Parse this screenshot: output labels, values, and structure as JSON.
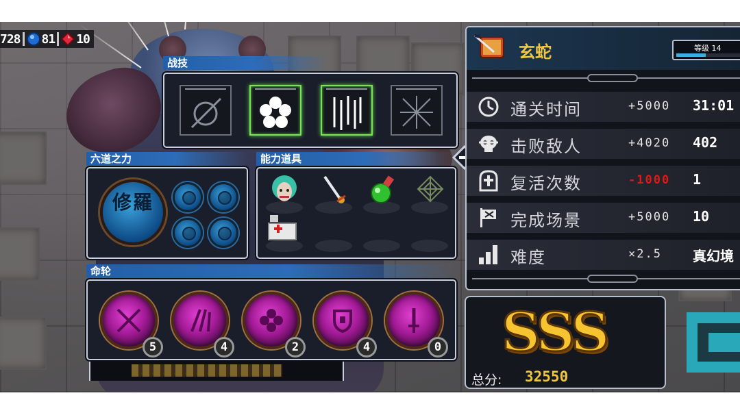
{
  "resources": {
    "coins": "728",
    "blue_gems": "81",
    "red_gems": "10"
  },
  "tabs": {
    "skills": "战技",
    "six_paths": "六道之力",
    "items": "能力道具",
    "fate": "命轮"
  },
  "six_paths": {
    "main_glyph": "修羅"
  },
  "fate_wheel": [
    {
      "icon": "crossed-sword-icon",
      "count": "5"
    },
    {
      "icon": "slash-icon",
      "count": "4"
    },
    {
      "icon": "flower-icon",
      "count": "2"
    },
    {
      "icon": "shield-icon",
      "count": "4"
    },
    {
      "icon": "sword-icon",
      "count": "0"
    }
  ],
  "character": {
    "name": "玄蛇",
    "level_label": "等级 14"
  },
  "stats": [
    {
      "label": "通关时间",
      "bonus": "+5000",
      "value": "31:01",
      "icon": "clock-icon",
      "negative": false
    },
    {
      "label": "击败敌人",
      "bonus": "+4020",
      "value": "402",
      "icon": "skull-icon",
      "negative": false
    },
    {
      "label": "复活次数",
      "bonus": "-1000",
      "value": "1",
      "icon": "tombstone-icon",
      "negative": true
    },
    {
      "label": "完成场景",
      "bonus": "+5000",
      "value": "10",
      "icon": "flag-icon",
      "negative": false
    },
    {
      "label": "难度",
      "bonus": "×2.5",
      "value": "真幻境",
      "icon": "difficulty-bars-icon",
      "negative": false
    }
  ],
  "result": {
    "rank": "SSS",
    "total_label": "总分:",
    "total_value": "32550"
  },
  "colors": {
    "tab_blue": "#2d6cb8",
    "active_skill_glow": "#7ee05a",
    "rank_gold": "#f5c430",
    "negative_red": "#e01818",
    "next_button_cyan": "#28a8b8"
  }
}
